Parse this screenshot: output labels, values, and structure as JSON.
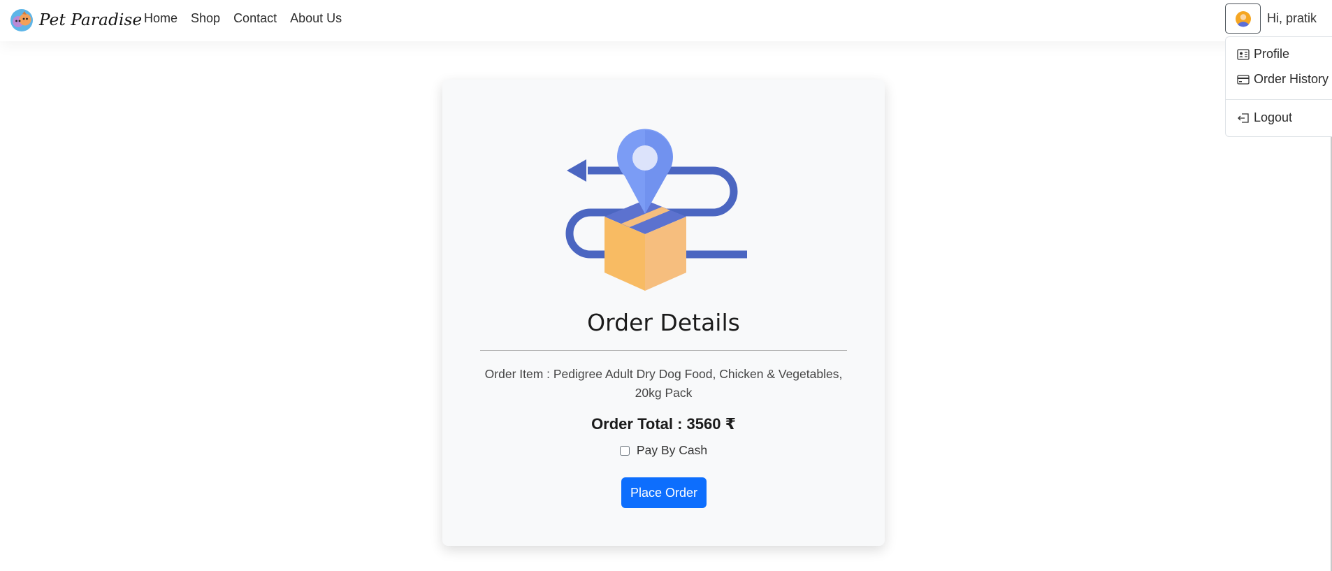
{
  "navbar": {
    "brand": "Pet Paradise",
    "brand_logo_icon": "pet-logo-icon",
    "links": [
      "Home",
      "Shop",
      "Contact",
      "About Us"
    ],
    "greeting": "Hi, pratik",
    "avatar_icon": "user-avatar-icon"
  },
  "user_menu": {
    "items": [
      {
        "label": "Profile",
        "icon": "profile-icon"
      },
      {
        "label": "Order History",
        "icon": "credit-card-icon"
      },
      {
        "label": "Logout",
        "icon": "logout-icon"
      }
    ]
  },
  "order": {
    "illustration_icon": "delivery-box-location-icon",
    "title": "Order Details",
    "item_line": "Order Item : Pedigree Adult Dry Dog Food, Chicken & Vegetables, 20kg Pack",
    "total_line": "Order Total : 3560 ₹",
    "payment_option_label": "Pay By Cash",
    "payment_option_checked": false,
    "submit_label": "Place Order"
  },
  "colors": {
    "primary": "#0d6efd",
    "card_bg": "#f8f9fa",
    "route": "#4b66c1",
    "pin": "#7b9cf5",
    "box": "#f8bb63"
  }
}
